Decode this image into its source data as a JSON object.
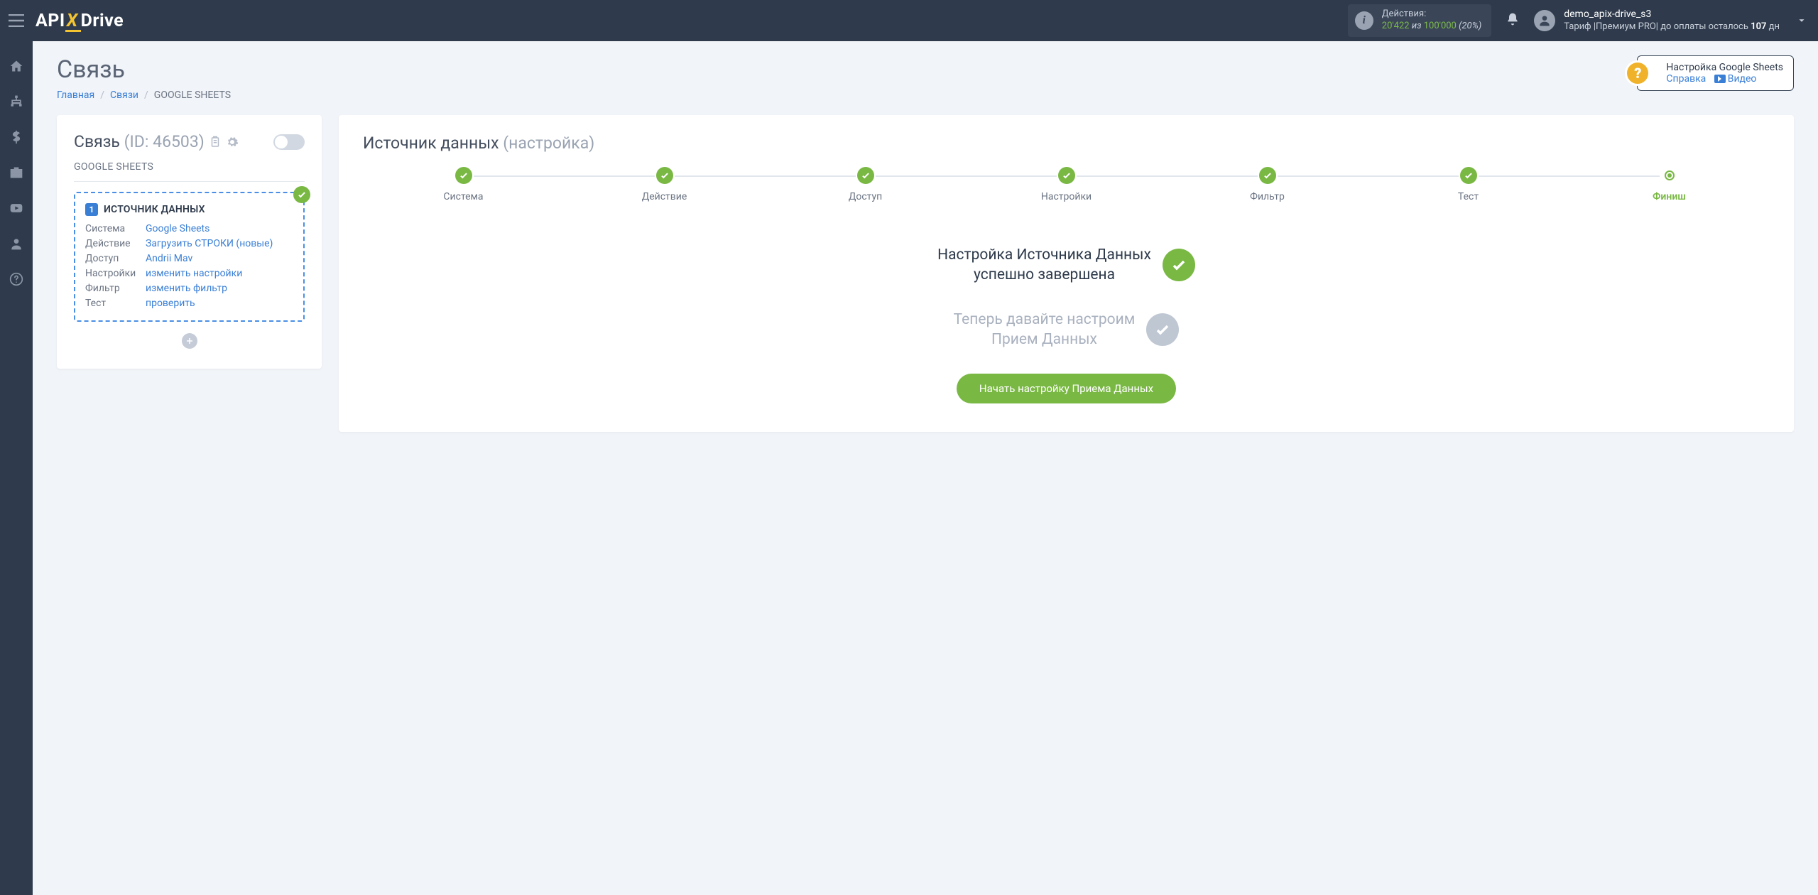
{
  "header": {
    "logo": {
      "p1": "API",
      "p2": "X",
      "p3": "Drive"
    },
    "actions": {
      "label": "Действия:",
      "used": "20'422",
      "of": "из",
      "total": "100'000",
      "pct": "(20%)"
    },
    "user": {
      "name": "demo_apix-drive_s3",
      "plan_prefix": "Тариф",
      "plan_name": "Премиум PRO",
      "plan_mid": "до оплаты осталось",
      "days": "107",
      "days_suffix": "дн"
    }
  },
  "page": {
    "title": "Связь",
    "breadcrumbs": {
      "home": "Главная",
      "links": "Связи",
      "current": "GOOGLE SHEETS"
    }
  },
  "help": {
    "title": "Настройка Google Sheets",
    "ref": "Справка",
    "video": "Видео"
  },
  "left": {
    "title": "Связь",
    "id": "(ID: 46503)",
    "subtitle": "GOOGLE SHEETS",
    "source_badge": "1",
    "source_title": "ИСТОЧНИК ДАННЫХ",
    "rows": {
      "system": {
        "lbl": "Система",
        "val": "Google Sheets"
      },
      "action": {
        "lbl": "Действие",
        "val": "Загрузить СТРОКИ (новые)"
      },
      "access": {
        "lbl": "Доступ",
        "val": "Andrii Mav"
      },
      "settings": {
        "lbl": "Настройки",
        "val": "изменить настройки"
      },
      "filter": {
        "lbl": "Фильтр",
        "val": "изменить фильтр"
      },
      "test": {
        "lbl": "Тест",
        "val": "проверить"
      }
    }
  },
  "right": {
    "title": "Источник данных",
    "title_muted": "(настройка)",
    "steps": [
      "Система",
      "Действие",
      "Доступ",
      "Настройки",
      "Фильтр",
      "Тест",
      "Финиш"
    ],
    "done_msg_l1": "Настройка Источника Данных",
    "done_msg_l2": "успешно завершена",
    "pending_msg_l1": "Теперь давайте настроим",
    "pending_msg_l2": "Прием Данных",
    "cta": "Начать настройку Приема Данных"
  }
}
